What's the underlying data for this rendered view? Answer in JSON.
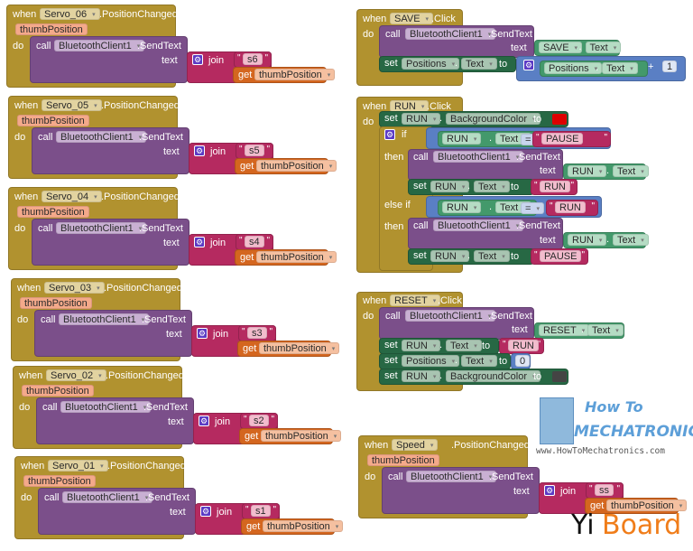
{
  "keywords": {
    "when": "when",
    "do": "do",
    "call": "call",
    "set": "set",
    "to": "to",
    "get": "get",
    "if": "if",
    "then": "then",
    "else_if": "else if",
    "text": "text",
    "join": "join",
    "dot": ".",
    "plus": "+",
    "eq": "="
  },
  "servo_events": [
    {
      "component": "Servo_06",
      "event": ".PositionChanged",
      "param": "thumbPosition",
      "target": "BluetoothClient1",
      "method": ".SendText",
      "string": "s6",
      "get_var": "thumbPosition"
    },
    {
      "component": "Servo_05",
      "event": ".PositionChanged",
      "param": "thumbPosition",
      "target": "BluetoothClient1",
      "method": ".SendText",
      "string": "s5",
      "get_var": "thumbPosition"
    },
    {
      "component": "Servo_04",
      "event": ".PositionChanged",
      "param": "thumbPosition",
      "target": "BluetoothClient1",
      "method": ".SendText",
      "string": "s4",
      "get_var": "thumbPosition"
    },
    {
      "component": "Servo_03",
      "event": ".PositionChanged",
      "param": "thumbPosition",
      "target": "BluetoothClient1",
      "method": ".SendText",
      "string": "s3",
      "get_var": "thumbPosition"
    },
    {
      "component": "Servo_02",
      "event": ".PositionChanged",
      "param": "thumbPosition",
      "target": "BluetoothClient1",
      "method": ".SendText",
      "string": "s2",
      "get_var": "thumbPosition"
    },
    {
      "component": "Servo_01",
      "event": ".PositionChanged",
      "param": "thumbPosition",
      "target": "BluetoothClient1",
      "method": ".SendText",
      "string": "s1",
      "get_var": "thumbPosition"
    },
    {
      "component": "Speed",
      "event": ".PositionChanged",
      "param": "thumbPosition",
      "target": "BluetoothClient1",
      "method": ".SendText",
      "string": "ss",
      "get_var": "thumbPosition"
    }
  ],
  "save_event": {
    "component": "SAVE",
    "event": ".Click",
    "target": "BluetoothClient1",
    "method": ".SendText",
    "text_component": "SAVE",
    "text_property": "Text",
    "set_component": "Positions",
    "set_property": "Text",
    "add_component": "Positions",
    "add_property": "Text",
    "add_number": "1"
  },
  "run_event": {
    "component": "RUN",
    "event": ".Click",
    "bg_component": "RUN",
    "bg_property": "BackgroundColor",
    "bg_color": "#dd0000",
    "if_component": "RUN",
    "if_property": "Text",
    "if_string": "PAUSE",
    "then1_target": "BluetoothClient1",
    "then1_method": ".SendText",
    "then1_text_component": "RUN",
    "then1_text_property": "Text",
    "then1_set_component": "RUN",
    "then1_set_property": "Text",
    "then1_set_string": "RUN",
    "elseif_component": "RUN",
    "elseif_property": "Text",
    "elseif_string": "RUN",
    "then2_target": "BluetoothClient1",
    "then2_method": ".SendText",
    "then2_text_component": "RUN",
    "then2_text_property": "Text",
    "then2_set_component": "RUN",
    "then2_set_property": "Text",
    "then2_set_string": "PAUSE"
  },
  "reset_event": {
    "component": "RESET",
    "event": ".Click",
    "target": "BluetoothClient1",
    "method": ".SendText",
    "text_component": "RESET",
    "text_property": "Text",
    "set1_component": "RUN",
    "set1_property": "Text",
    "set1_string": "RUN",
    "set2_component": "Positions",
    "set2_property": "Text",
    "set2_number": "0",
    "set3_component": "RUN",
    "set3_property": "BackgroundColor",
    "set3_color": "#444444"
  },
  "colors": {
    "event": "#b1922f",
    "call": "#7b4f8a",
    "text": "#b52a60",
    "variable": "#d4661f",
    "getter": "#43996b",
    "setter": "#276844",
    "math": "#5a7fc4"
  },
  "logos": {
    "howto_line1": "How To",
    "howto_line2": "MECHATRONICS",
    "howto_url": "www.HowToMechatronics.com",
    "yiboard_1": "Yi",
    "yiboard_2": "Board"
  }
}
